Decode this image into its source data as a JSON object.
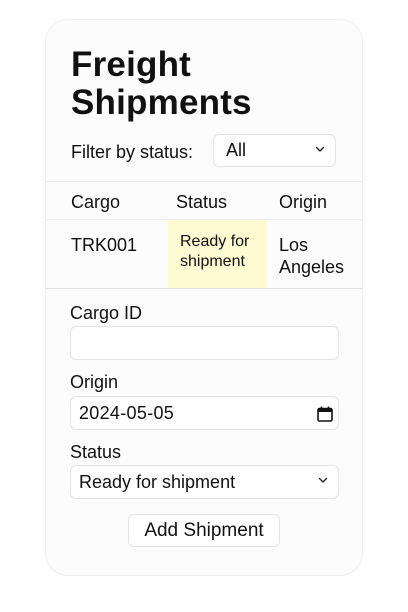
{
  "title": {
    "line1": "Freight",
    "line2": "Shipments"
  },
  "filter": {
    "label": "Filter by status:",
    "selected": "All"
  },
  "table": {
    "columns": [
      "Cargo",
      "Status",
      "Origin"
    ],
    "rows": [
      {
        "cargo": "TRK001",
        "status_line1": "Ready for",
        "status_line2": "shipment",
        "origin_line1": "Los",
        "origin_line2": "Angeles"
      }
    ],
    "status_highlight_color": "#fefad2"
  },
  "form": {
    "cargo_id_label": "Cargo ID",
    "cargo_id_value": "",
    "origin_label": "Origin",
    "origin_value": "2024-05-05",
    "status_label": "Status",
    "status_selected": "Ready for shipment",
    "submit_label": "Add Shipment"
  },
  "icons": [
    "chevron-down-icon",
    "calendar-icon"
  ]
}
